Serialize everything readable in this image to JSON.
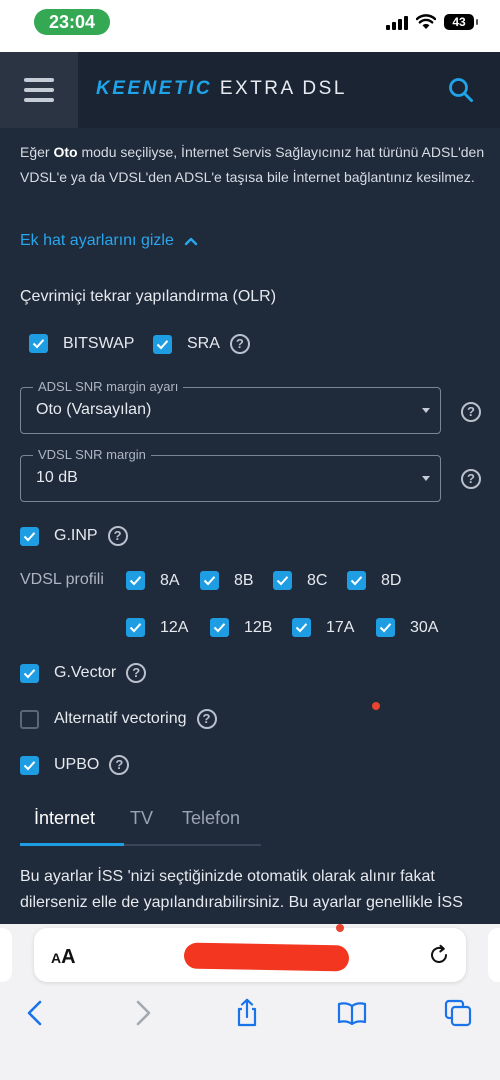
{
  "status_bar": {
    "time": "23:04",
    "battery": "43"
  },
  "header": {
    "brand_primary": "KEENETIC",
    "brand_secondary": "EXTRA DSL"
  },
  "note": {
    "part1": "Eğer ",
    "bold": "Oto",
    "part2": " modu seçiliyse, İnternet Servis Sağlayıcınız hat türünü ADSL'den VDSL'e ya da VDSL'den ADSL'e taşısa bile İnternet bağlantınız kesilmez."
  },
  "toggle_link": "Ek hat ayarlarını gizle",
  "olr": {
    "title": "Çevrimiçi tekrar yapılandırma (OLR)",
    "bitswap": {
      "label": "BITSWAP",
      "checked": true
    },
    "sra": {
      "label": "SRA",
      "checked": true
    }
  },
  "adsl_snr": {
    "legend": "ADSL SNR margin ayarı",
    "value": "Oto (Varsayılan)"
  },
  "vdsl_snr": {
    "legend": "VDSL SNR margin",
    "value": "10 dB"
  },
  "ginp": {
    "label": "G.INP",
    "checked": true
  },
  "vdsl_profile": {
    "label": "VDSL profili",
    "options": [
      {
        "label": "8A",
        "checked": true
      },
      {
        "label": "8B",
        "checked": true
      },
      {
        "label": "8C",
        "checked": true
      },
      {
        "label": "8D",
        "checked": true
      },
      {
        "label": "12A",
        "checked": true
      },
      {
        "label": "12B",
        "checked": true
      },
      {
        "label": "17A",
        "checked": true
      },
      {
        "label": "30A",
        "checked": true
      }
    ]
  },
  "gvector": {
    "label": "G.Vector",
    "checked": true
  },
  "alt_vectoring": {
    "label": "Alternatif vectoring",
    "checked": false
  },
  "upbo": {
    "label": "UPBO",
    "checked": true
  },
  "tabs": [
    {
      "label": "İnternet",
      "active": true
    },
    {
      "label": "TV",
      "active": false
    },
    {
      "label": "Telefon",
      "active": false
    }
  ],
  "body_text": "Bu ayarlar İSS 'nizi seçtiğinizde otomatik olarak alınır fakat dilerseniz elle de yapılandırabilirsiniz. Bu ayarlar genellikle İSS",
  "safari": {
    "text_size": "AA"
  },
  "colors": {
    "accent": "#1e9de3",
    "background": "#1f2a3a",
    "header": "#1b2432",
    "status_green": "#34a853"
  }
}
